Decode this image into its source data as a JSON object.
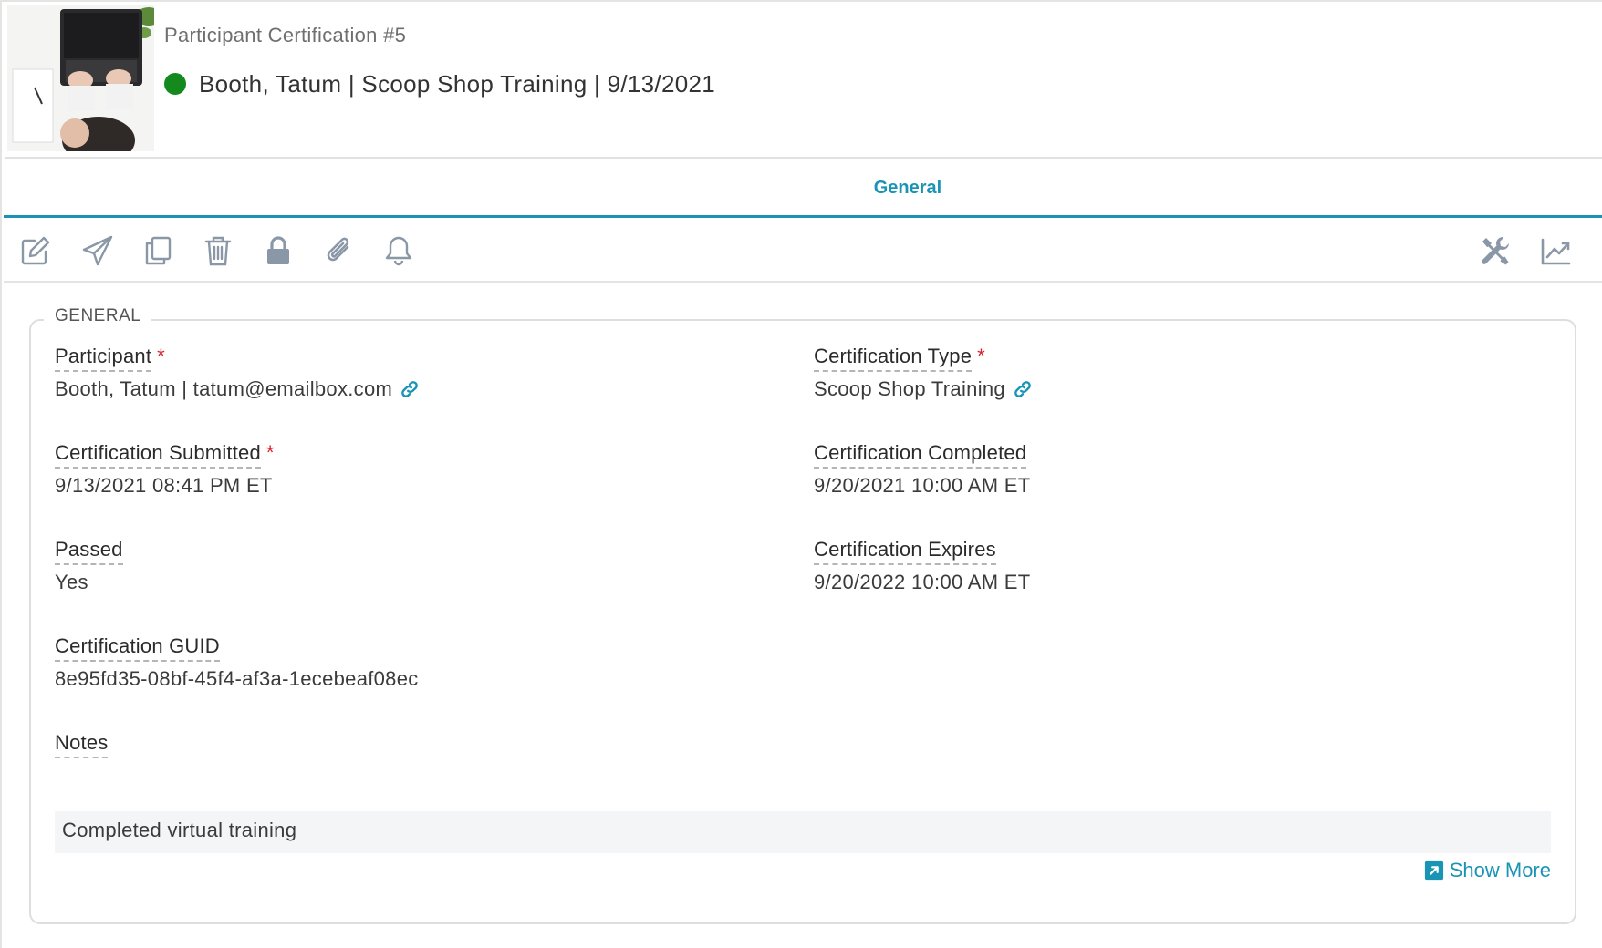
{
  "header": {
    "subtitle": "Participant Certification #5",
    "title": "Booth, Tatum | Scoop Shop Training | 9/13/2021",
    "status_color": "#148a1e"
  },
  "tabs": [
    {
      "label": "General",
      "active": true
    }
  ],
  "toolbar": {
    "left_icons": [
      "edit-icon",
      "send-icon",
      "copy-icon",
      "delete-icon",
      "lock-icon",
      "attach-icon",
      "bell-icon"
    ],
    "right_icons": [
      "tools-icon",
      "chart-icon"
    ]
  },
  "general": {
    "legend": "GENERAL",
    "participant": {
      "label": "Participant",
      "required": "*",
      "value": "Booth, Tatum | tatum@emailbox.com"
    },
    "certification_type": {
      "label": "Certification Type",
      "required": "*",
      "value": "Scoop Shop Training"
    },
    "certification_submitted": {
      "label": "Certification Submitted",
      "required": "*",
      "value": "9/13/2021 08:41 PM ET"
    },
    "certification_completed": {
      "label": "Certification Completed",
      "value": "9/20/2021 10:00 AM ET"
    },
    "passed": {
      "label": "Passed",
      "value": "Yes"
    },
    "certification_expires": {
      "label": "Certification Expires",
      "value": "9/20/2022 10:00 AM ET"
    },
    "certification_guid": {
      "label": "Certification GUID",
      "value": "8e95fd35-08bf-45f4-af3a-1ecebeaf08ec"
    },
    "notes": {
      "label": "Notes",
      "value": "Completed virtual training"
    },
    "show_more": "Show More"
  },
  "colors": {
    "accent": "#1a94b5",
    "required": "#d9232b",
    "icon": "#8a97a6"
  }
}
